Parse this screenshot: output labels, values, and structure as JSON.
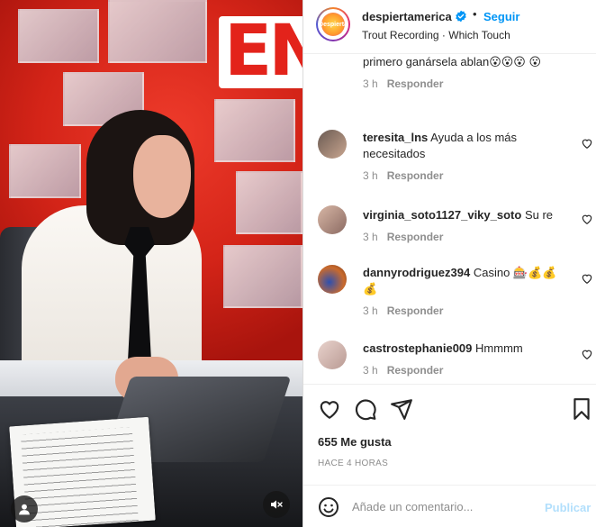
{
  "post": {
    "username": "despiertamerica",
    "follow_label": "Seguir",
    "separator": "•",
    "audio": "Trout Recording · Which Touch",
    "logo_text": "Despierta"
  },
  "comments": [
    {
      "username": "",
      "text": "primero ganársela ablan😮😮😮 😮",
      "time": "3 h",
      "reply": "Responder",
      "likeable": false
    },
    {
      "username": "teresita_lns",
      "text": "Ayuda a los más necesitados",
      "time": "3 h",
      "reply": "Responder",
      "likeable": true
    },
    {
      "username": "virginia_soto1127_viky_soto",
      "text": "Su re",
      "time": "3 h",
      "reply": "Responder",
      "likeable": true
    },
    {
      "username": "dannyrodriguez394",
      "text": "Casino 🎰💰💰 💰",
      "time": "3 h",
      "reply": "Responder",
      "likeable": true
    },
    {
      "username": "castrostephanie009",
      "text": "Hmmmm",
      "time": "3 h",
      "reply": "Responder",
      "likeable": true
    }
  ],
  "stats": {
    "likes": "655 Me gusta",
    "posted": "HACE 4 HORAS"
  },
  "composer": {
    "placeholder": "Añade un comentario...",
    "publish": "Publicar"
  },
  "media": {
    "banner_text": "EN"
  },
  "colors": {
    "link_blue": "#0095f6",
    "publish_disabled": "#b2dffc",
    "muted": "#8e8e8e"
  }
}
